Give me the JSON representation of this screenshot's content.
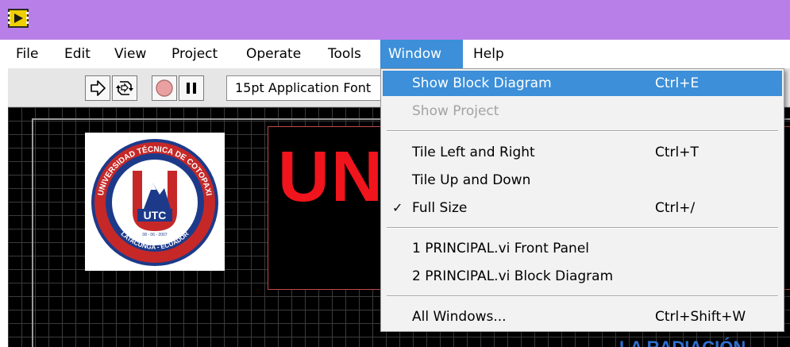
{
  "window": {
    "app_icon": "labview-run-icon",
    "titlebar_color": "#b97fe8"
  },
  "menubar": {
    "items": [
      {
        "label": "File"
      },
      {
        "label": "Edit"
      },
      {
        "label": "View"
      },
      {
        "label": "Project"
      },
      {
        "label": "Operate"
      },
      {
        "label": "Tools"
      },
      {
        "label": "Window",
        "active": true
      },
      {
        "label": "Help"
      }
    ],
    "active_color": "#3c8fd8"
  },
  "toolbar": {
    "run_icon": "run-arrow-icon",
    "run_continuously_icon": "run-continuously-icon",
    "abort_icon": "abort-stop-icon",
    "pause_icon": "pause-icon",
    "font_select_value": "15pt Application Font"
  },
  "front_panel": {
    "logo": {
      "top_text": "UNIVERSIDAD TÉCNICA DE COTOPAXI",
      "side_text": "POR LA VINCULACIÓN DE LA UNIVERSIDAD CON EL PUEBLO",
      "date_text": "08 - 06 - 2007",
      "bottom_text": "LATACUNGA - ECUADOR",
      "mark_text": "UTC"
    },
    "title_text": "UN",
    "title_color": "#f0141c",
    "subtitle_text": "LA RADIACIÓN"
  },
  "window_menu": {
    "items": [
      {
        "label": "Show Block Diagram",
        "shortcut": "Ctrl+E",
        "highlighted": true
      },
      {
        "label": "Show Project",
        "shortcut": "",
        "disabled": true
      },
      {
        "label": "Tile Left and Right",
        "shortcut": "Ctrl+T"
      },
      {
        "label": "Tile Up and Down",
        "shortcut": ""
      },
      {
        "label": "Full Size",
        "shortcut": "Ctrl+/",
        "checked": true,
        "check_mark": "✓"
      },
      {
        "label": "1 PRINCIPAL.vi Front Panel",
        "shortcut": ""
      },
      {
        "label": "2 PRINCIPAL.vi Block Diagram",
        "shortcut": ""
      },
      {
        "label": "All Windows...",
        "shortcut": "Ctrl+Shift+W"
      }
    ]
  }
}
